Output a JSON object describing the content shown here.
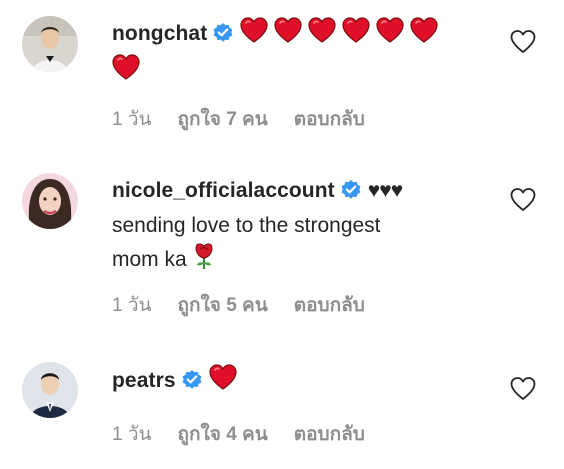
{
  "comments": [
    {
      "username": "nongchat",
      "verified": true,
      "text_lines": [
        ""
      ],
      "emoji": [
        "red-heart",
        "red-heart",
        "red-heart",
        "red-heart",
        "red-heart",
        "red-heart",
        "red-heart"
      ],
      "time": "1 วัน",
      "likes": "ถูกใจ 7 คน",
      "reply": "ตอบกลับ"
    },
    {
      "username": "nicole_officialaccount",
      "verified": true,
      "inline_text": "♥♥♥",
      "text_lines": [
        "sending love to the strongest",
        "mom ka"
      ],
      "emoji": [
        "rose"
      ],
      "time": "1 วัน",
      "likes": "ถูกใจ 5 คน",
      "reply": "ตอบกลับ"
    },
    {
      "username": "peatrs",
      "verified": true,
      "emoji": [
        "red-heart"
      ],
      "time": "1 วัน",
      "likes": "ถูกใจ 4 คน",
      "reply": "ตอบกลับ"
    }
  ],
  "colors": {
    "text": "#262626",
    "meta": "#8e8e8e",
    "verified": "#3897f0",
    "heart": "#e0102b"
  }
}
